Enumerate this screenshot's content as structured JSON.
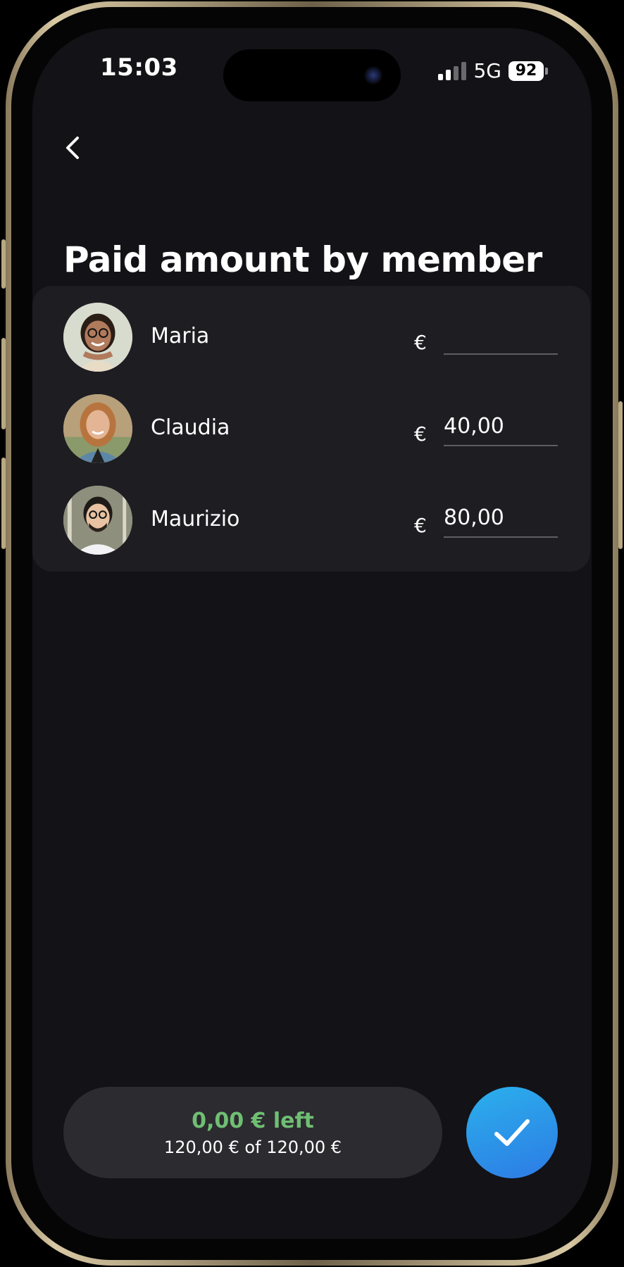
{
  "status_bar": {
    "time": "15:03",
    "network": "5G",
    "battery": "92"
  },
  "header": {
    "back_icon": "chevron-left-icon",
    "title": "Paid amount by member"
  },
  "members": [
    {
      "name": "Maria",
      "currency": "€",
      "amount": "",
      "avatar_colors": {
        "bg": "#d8dccf",
        "skin": "#b07a5c",
        "hair": "#2a1d16",
        "shirt": "#e9dcc7"
      }
    },
    {
      "name": "Claudia",
      "currency": "€",
      "amount": "40,00",
      "avatar_colors": {
        "bg": "#b7a07a",
        "skin": "#e3b594",
        "hair": "#b8743e",
        "shirt": "#5d87a8"
      }
    },
    {
      "name": "Maurizio",
      "currency": "€",
      "amount": "80,00",
      "avatar_colors": {
        "bg": "#8e8f7c",
        "skin": "#e8c2a2",
        "hair": "#1e1a18",
        "shirt": "#f2f2f4"
      }
    }
  ],
  "summary": {
    "left_text": "0,00 € left",
    "total_text": "120,00 € of 120,00 €"
  },
  "confirm": {
    "icon": "checkmark-icon"
  },
  "colors": {
    "background": "#131216",
    "card": "#1e1d22",
    "positive": "#6fbf73",
    "accent_start": "#2bb0ec",
    "accent_end": "#2d7be4"
  }
}
